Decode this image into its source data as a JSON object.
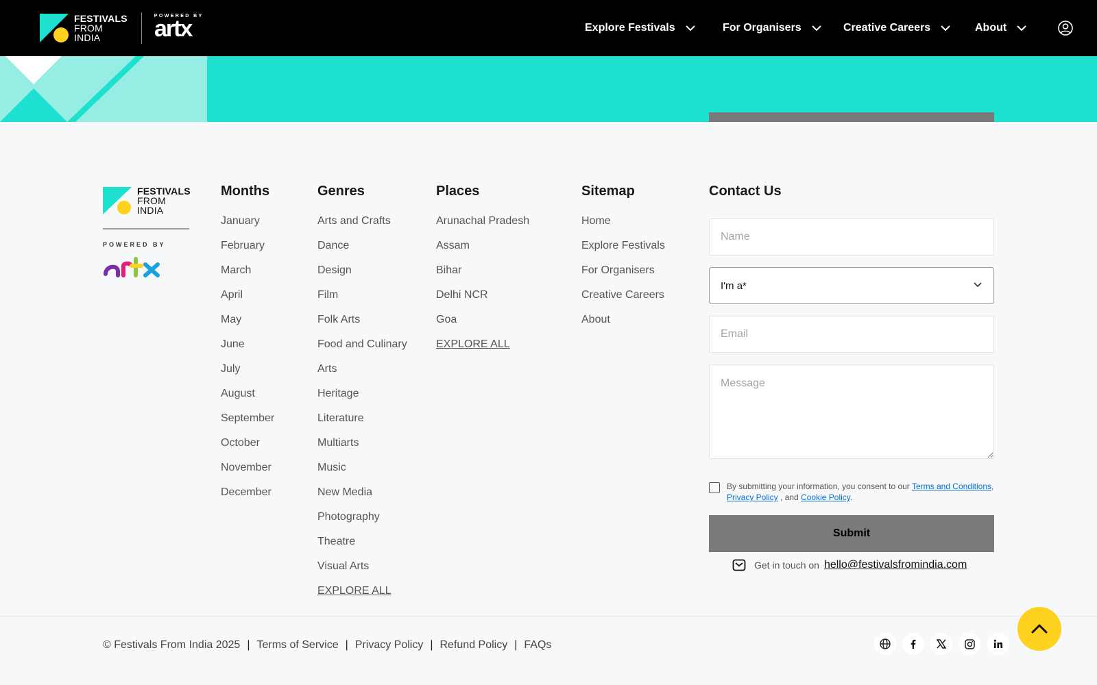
{
  "header": {
    "brand_line1": "FESTIVALS",
    "brand_line2": "FROM",
    "brand_line3": "INDIA",
    "powered_by": "POWERED BY",
    "partner_logo_text": "artx",
    "nav": [
      {
        "label": "Explore Festivals"
      },
      {
        "label": "For Organisers"
      },
      {
        "label": "Creative Careers"
      },
      {
        "label": "About"
      }
    ],
    "account_icon": "user-circle-icon"
  },
  "footer": {
    "months": {
      "title": "Months",
      "items": [
        "January",
        "February",
        "March",
        "April",
        "May",
        "June",
        "July",
        "August",
        "September",
        "October",
        "November",
        "December"
      ]
    },
    "genres": {
      "title": "Genres",
      "items": [
        "Arts and Crafts",
        "Dance",
        "Design",
        "Film",
        "Folk Arts",
        "Food and Culinary",
        "Arts",
        "Heritage",
        "Literature",
        "Multiarts",
        "Music",
        "New Media",
        "Photography",
        "Theatre",
        "Visual Arts"
      ],
      "explore": "EXPLORE ALL"
    },
    "places": {
      "title": "Places",
      "items": [
        "Arunachal Pradesh",
        "Assam",
        "Bihar",
        "Delhi NCR",
        "Goa"
      ],
      "explore": "EXPLORE ALL"
    },
    "sitemap": {
      "title": "Sitemap",
      "items": [
        "Home",
        "Explore Festivals",
        "For Organisers",
        "Creative Careers",
        "About"
      ]
    },
    "contact": {
      "title": "Contact Us",
      "name_placeholder": "Name",
      "role_value": "I'm a*",
      "email_placeholder": "Email",
      "message_placeholder": "Message",
      "consent_prefix": "By submitting your information, you consent to our",
      "terms_link": "Terms and Conditions",
      "comma": ",",
      "privacy_link": "Privacy Policy",
      "and_text": ", and",
      "cookie_link": "Cookie Policy",
      "period": ".",
      "submit_label": "Submit",
      "get_in_touch": "Get in touch on",
      "email": "hello@festivalsfromindia.com"
    }
  },
  "bottom": {
    "copyright": "© Festivals From India 2025",
    "links": [
      "Terms of Service",
      "Privacy Policy",
      "Refund Policy",
      "FAQs"
    ],
    "separator": "|",
    "socials": [
      "globe-icon",
      "facebook-icon",
      "x-icon",
      "instagram-icon",
      "linkedin-icon"
    ]
  },
  "colors": {
    "nav_bg": "#000000",
    "teal": "#1ee0cf",
    "teal_light": "#96ede3",
    "scroll_top": "#ffd21f",
    "submit_bg": "#7a7a7a",
    "link_blue": "#0a6fd1"
  }
}
